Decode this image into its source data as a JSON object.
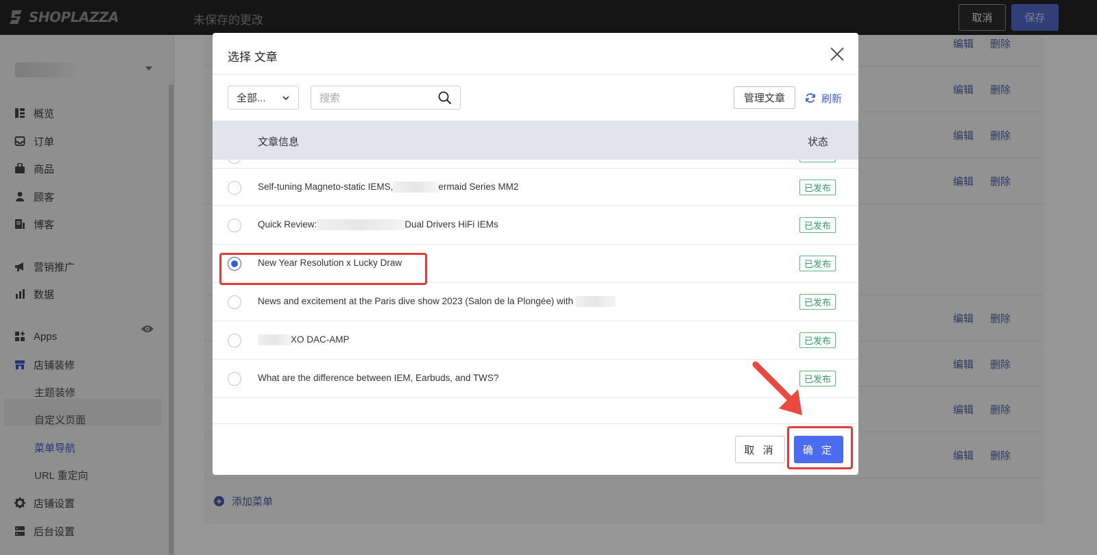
{
  "topbar": {
    "logo_text": "SHOPLAZZA",
    "unsaved_text": "未保存的更改",
    "cancel_label": "取消",
    "save_label": "保存"
  },
  "sidebar": {
    "items": [
      {
        "label": "概览",
        "icon": "dashboard-icon"
      },
      {
        "label": "订单",
        "icon": "inbox-icon"
      },
      {
        "label": "商品",
        "icon": "bag-icon"
      },
      {
        "label": "顾客",
        "icon": "person-icon"
      },
      {
        "label": "博客",
        "icon": "blog-icon"
      },
      {
        "label": "营销推广",
        "icon": "megaphone-icon"
      },
      {
        "label": "数据",
        "icon": "bar-chart-icon"
      },
      {
        "label": "Apps",
        "icon": "apps-icon"
      },
      {
        "label": "店铺装修",
        "icon": "store-icon"
      }
    ],
    "sub_items": [
      "主题装修",
      "自定义页面",
      "菜单导航",
      "URL 重定向"
    ],
    "active_sub": "菜单导航",
    "bottom_items": [
      {
        "label": "店铺设置",
        "icon": "gear-icon"
      },
      {
        "label": "后台设置",
        "icon": "server-icon"
      }
    ]
  },
  "background": {
    "edit_label": "编辑",
    "delete_label": "删除",
    "add_menu_label": "添加菜单"
  },
  "modal": {
    "title": "选择 文章",
    "filter_value": "全部...",
    "search_placeholder": "搜索",
    "manage_label": "管理文章",
    "refresh_label": "刷新",
    "col_info": "文章信息",
    "col_status": "状态",
    "rows": [
      {
        "title": "Self-tuning Magneto-static IEMS,",
        "title_tail": "ermaid Series MM2",
        "status": "已发布",
        "checked": false
      },
      {
        "title": "Quick Review:",
        "title_tail": "Dual Drivers HiFi IEMs",
        "status": "已发布",
        "checked": false
      },
      {
        "title": "New Year Resolution x Lucky Draw",
        "title_tail": "",
        "status": "已发布",
        "checked": true
      },
      {
        "title": "News and excitement at the Paris dive show 2023 (Salon de la Plongée) with",
        "title_tail": "",
        "status": "已发布",
        "checked": false
      },
      {
        "title": "",
        "title_tail": "XO DAC-AMP",
        "status": "已发布",
        "checked": false
      },
      {
        "title": "What are the difference between IEM, Earbuds, and TWS?",
        "title_tail": "",
        "status": "已发布",
        "checked": false
      }
    ],
    "cancel_label": "取 消",
    "ok_label": "确 定"
  },
  "colors": {
    "accent": "#4c6cf0",
    "annotation": "#e03c3c",
    "published": "#2f9e5f"
  }
}
